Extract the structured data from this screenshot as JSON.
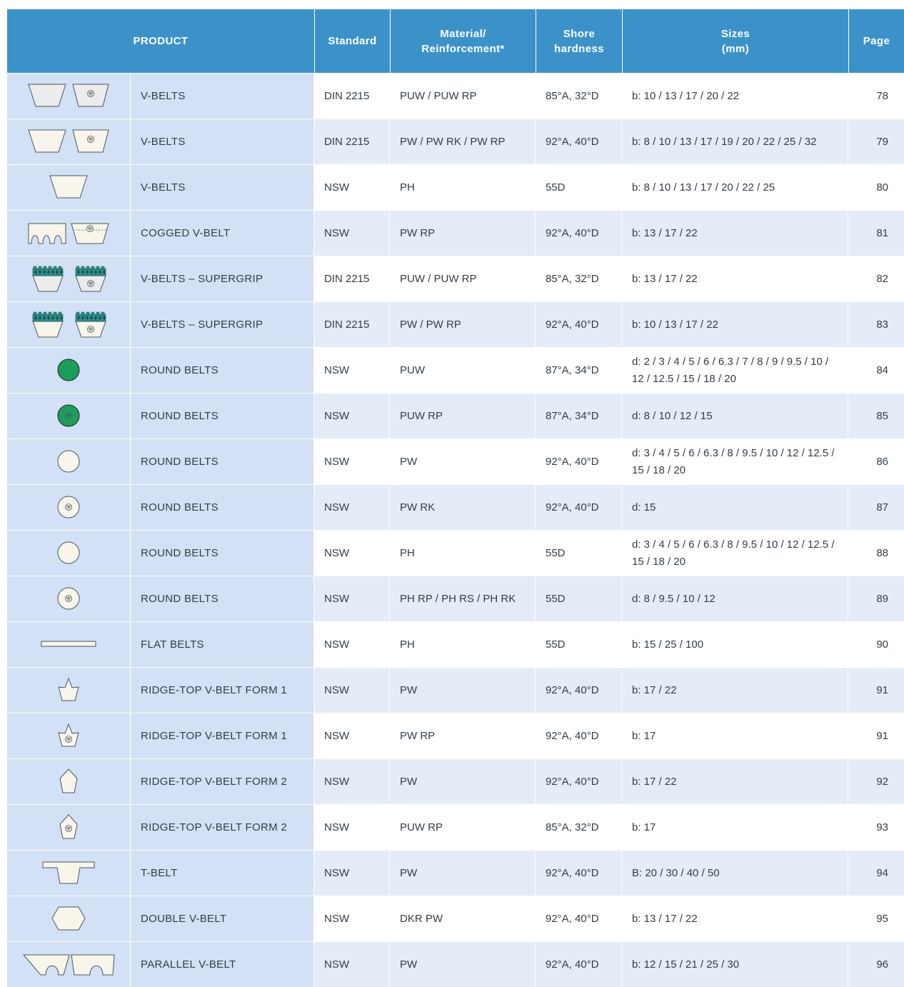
{
  "header": {
    "product": "PRODUCT",
    "standard": "Standard",
    "material": "Material/\nReinforcement*",
    "shore": "Shore\nhardness",
    "sizes": "Sizes\n(mm)",
    "page": "Page"
  },
  "colors": {
    "header_bg": "#3b92c9",
    "product_bg": "#d2e1f5",
    "row_alt_bg": "#e4ecf8",
    "belt_fill": "#f8f6ea",
    "round_green": "#1a9e5a",
    "grip_teal": "#2a8f8a"
  },
  "rows": [
    {
      "icon": "v-belt-pair-grey-icon",
      "product": "V-BELTS",
      "standard": "DIN 2215",
      "material": "PUW / PUW RP",
      "shore": "85°A, 32°D",
      "sizes": "b:  10 / 13 / 17 / 20 / 22",
      "page": "78"
    },
    {
      "icon": "v-belt-pair-icon",
      "product": "V-BELTS",
      "standard": "DIN 2215",
      "material": "PW / PW RK / PW RP",
      "shore": "92°A, 40°D",
      "sizes": "b: 8 / 10 / 13 / 17 / 19 / 20 / 22 / 25 / 32",
      "page": "79"
    },
    {
      "icon": "v-belt-icon",
      "product": "V-BELTS",
      "standard": "NSW",
      "material": "PH",
      "shore": "55D",
      "sizes": "b: 8 / 10 / 13 / 17 / 20 / 22 / 25",
      "page": "80"
    },
    {
      "icon": "cogged-v-belt-icon",
      "product": "COGGED V-BELT",
      "standard": "NSW",
      "material": "PW RP",
      "shore": "92°A, 40°D",
      "sizes": "b: 13 / 17 / 22",
      "page": "81"
    },
    {
      "icon": "supergrip-v-belt-grey-icon",
      "product": "V-BELTS – SUPERGRIP",
      "standard": "DIN 2215",
      "material": "PUW / PUW RP",
      "shore": "85°A, 32°D",
      "sizes": "b: 13 / 17 / 22",
      "page": "82"
    },
    {
      "icon": "supergrip-v-belt-icon",
      "product": "V-BELTS – SUPERGRIP",
      "standard": "DIN 2215",
      "material": "PW / PW RP",
      "shore": "92°A, 40°D",
      "sizes": "b: 10 / 13 / 17 / 22",
      "page": "83"
    },
    {
      "icon": "round-belt-green-icon",
      "product": "ROUND BELTS",
      "standard": "NSW",
      "material": "PUW",
      "shore": "87°A, 34°D",
      "sizes": "d: 2 / 3 / 4 / 5 / 6 / 6.3 / 7 / 8 / 9 / 9.5 / 10 / 12 / 12.5 / 15 / 18 / 20",
      "page": "84"
    },
    {
      "icon": "round-belt-green-reinforced-icon",
      "product": "ROUND BELTS",
      "standard": "NSW",
      "material": "PUW RP",
      "shore": "87°A, 34°D",
      "sizes": "d: 8 / 10 / 12 / 15",
      "page": "85"
    },
    {
      "icon": "round-belt-icon",
      "product": "ROUND BELTS",
      "standard": "NSW",
      "material": "PW",
      "shore": "92°A, 40°D",
      "sizes": "d: 3 / 4 / 5 / 6 / 6.3 / 8 / 9.5 / 10 / 12 / 12.5 / 15 / 18 / 20",
      "page": "86"
    },
    {
      "icon": "round-belt-reinforced-icon",
      "product": "ROUND BELTS",
      "standard": "NSW",
      "material": "PW RK",
      "shore": "92°A, 40°D",
      "sizes": "d: 15",
      "page": "87"
    },
    {
      "icon": "round-belt-icon",
      "product": "ROUND BELTS",
      "standard": "NSW",
      "material": "PH",
      "shore": "55D",
      "sizes": "d: 3 / 4 / 5 / 6 / 6.3 / 8 / 9.5 / 10 / 12 / 12.5 / 15 / 18 / 20",
      "page": "88"
    },
    {
      "icon": "round-belt-reinforced-icon",
      "product": "ROUND BELTS",
      "standard": "NSW",
      "material": "PH RP / PH RS / PH RK",
      "shore": "55D",
      "sizes": "d: 8 / 9.5 / 10 / 12",
      "page": "89"
    },
    {
      "icon": "flat-belt-icon",
      "product": "FLAT BELTS",
      "standard": "NSW",
      "material": "PH",
      "shore": "55D",
      "sizes": "b: 15 / 25 / 100",
      "page": "90"
    },
    {
      "icon": "ridge-top-form1-icon",
      "product": "RIDGE-TOP V-BELT  FORM 1",
      "standard": "NSW",
      "material": "PW",
      "shore": "92°A, 40°D",
      "sizes": "b: 17 / 22",
      "page": "91"
    },
    {
      "icon": "ridge-top-form1-reinforced-icon",
      "product": "RIDGE-TOP V-BELT  FORM 1",
      "standard": "NSW",
      "material": "PW RP",
      "shore": "92°A, 40°D",
      "sizes": "b: 17",
      "page": "91"
    },
    {
      "icon": "ridge-top-form2-icon",
      "product": "RIDGE-TOP V-BELT  FORM 2",
      "standard": "NSW",
      "material": "PW",
      "shore": "92°A, 40°D",
      "sizes": "b: 17 / 22",
      "page": "92"
    },
    {
      "icon": "ridge-top-form2-reinforced-icon",
      "product": "RIDGE-TOP V-BELT  FORM 2",
      "standard": "NSW",
      "material": "PUW RP",
      "shore": "85°A, 32°D",
      "sizes": "b: 17",
      "page": "93"
    },
    {
      "icon": "t-belt-icon",
      "product": "T-BELT",
      "standard": "NSW",
      "material": "PW",
      "shore": "92°A, 40°D",
      "sizes": "B: 20 / 30 / 40 / 50",
      "page": "94"
    },
    {
      "icon": "double-v-belt-icon",
      "product": "DOUBLE V-BELT",
      "standard": "NSW",
      "material": "DKR PW",
      "shore": "92°A, 40°D",
      "sizes": "b: 13 / 17 / 22",
      "page": "95"
    },
    {
      "icon": "parallel-v-belt-icon",
      "product": "PARALLEL V-BELT",
      "standard": "NSW",
      "material": "PW",
      "shore": "92°A, 40°D",
      "sizes": "b: 12 / 15 / 21 / 25 / 30",
      "page": "96"
    }
  ]
}
